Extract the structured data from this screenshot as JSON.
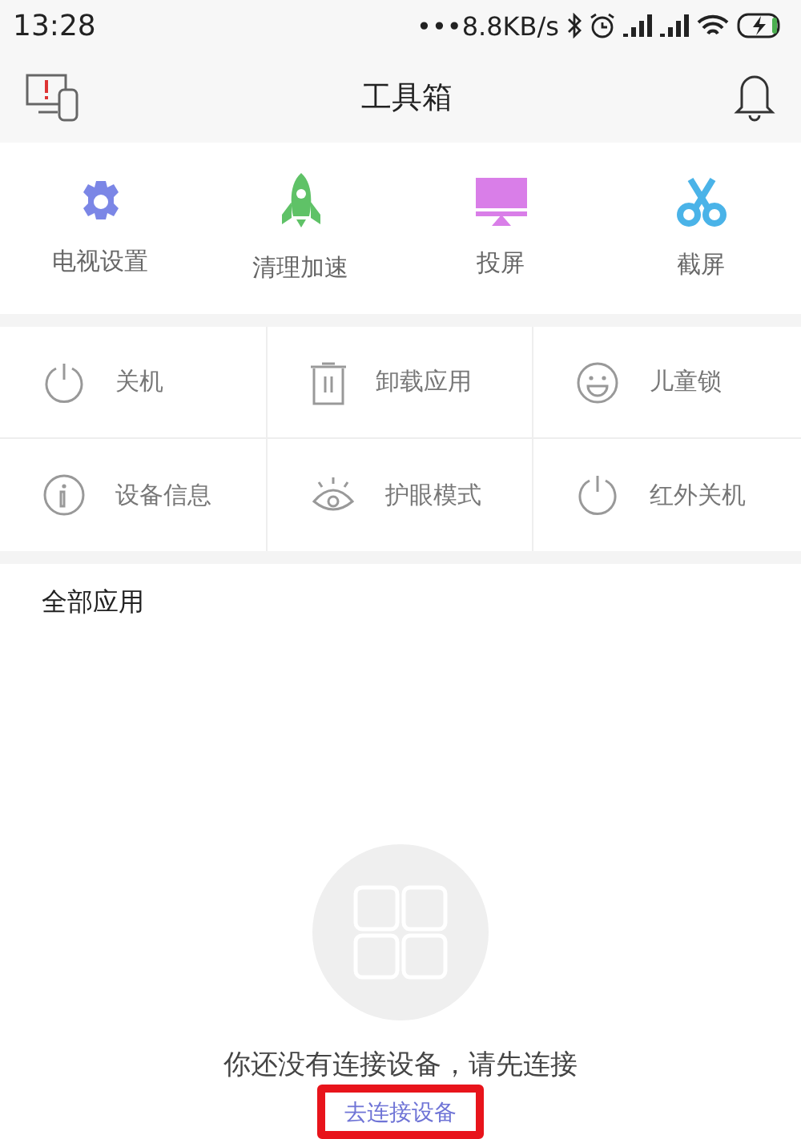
{
  "status_bar": {
    "time": "13:28",
    "speed": "•••8.8KB/s"
  },
  "header": {
    "title": "工具箱"
  },
  "quick_tools": [
    {
      "label": "电视设置",
      "color": "#7b86e6"
    },
    {
      "label": "清理加速",
      "color": "#5fc267"
    },
    {
      "label": "投屏",
      "color": "#d97ee8"
    },
    {
      "label": "截屏",
      "color": "#4ab3e8"
    }
  ],
  "tools": [
    {
      "label": "关机"
    },
    {
      "label": "卸载应用"
    },
    {
      "label": "儿童锁"
    },
    {
      "label": "设备信息"
    },
    {
      "label": "护眼模式"
    },
    {
      "label": "红外关机"
    }
  ],
  "section": {
    "title": "全部应用"
  },
  "empty_state": {
    "message": "你还没有连接设备，请先连接",
    "link": "去连接设备"
  }
}
